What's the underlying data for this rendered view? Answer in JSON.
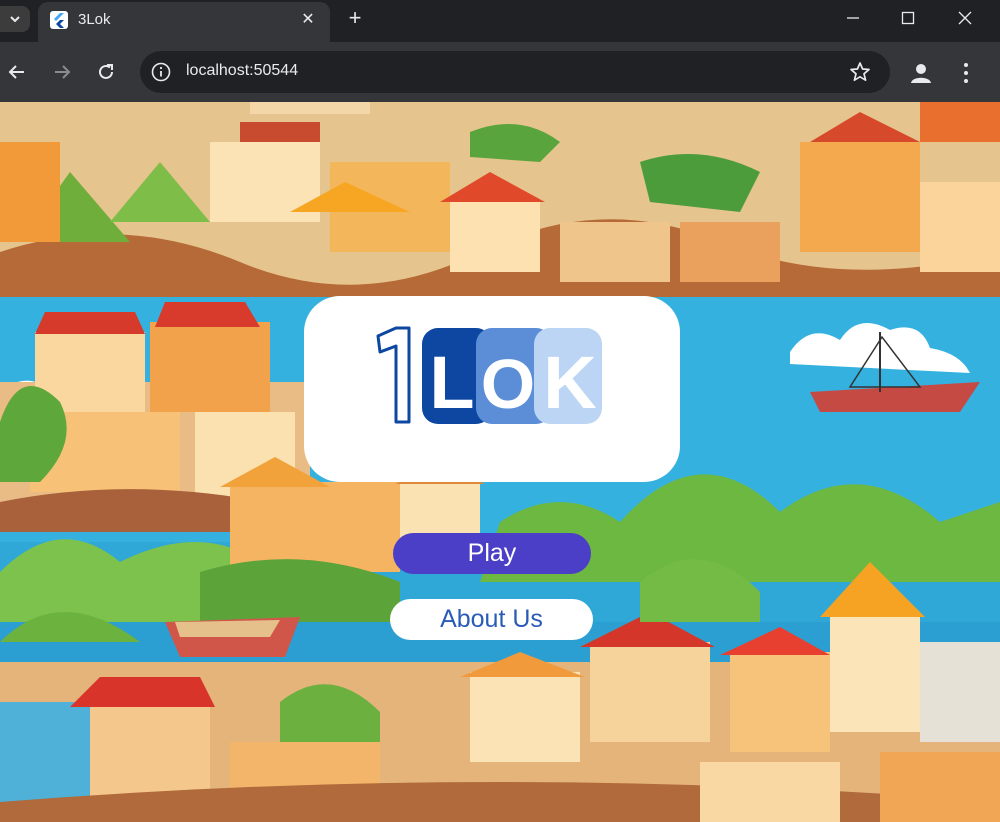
{
  "browser": {
    "tab_title": "3Lok",
    "url": "localhost:50544",
    "icons": {
      "tab_search": "chevron-down-icon",
      "favicon": "flutter-icon",
      "tab_close": "close-icon",
      "new_tab": "plus-icon",
      "back": "arrow-left-icon",
      "forward": "arrow-right-icon",
      "reload": "reload-icon",
      "site_info": "info-icon",
      "bookmark": "star-icon",
      "profile": "person-icon",
      "menu": "kebab-menu-icon"
    }
  },
  "app": {
    "logo": {
      "digit": "1",
      "letters": [
        "L",
        "O",
        "K"
      ],
      "colors": [
        "#0d47a1",
        "#5b8ed6",
        "#bcd5f5"
      ]
    },
    "play_label": "Play",
    "about_label": "About Us",
    "accent": "#4a3fc6",
    "about_text_color": "#2a5bb8"
  }
}
